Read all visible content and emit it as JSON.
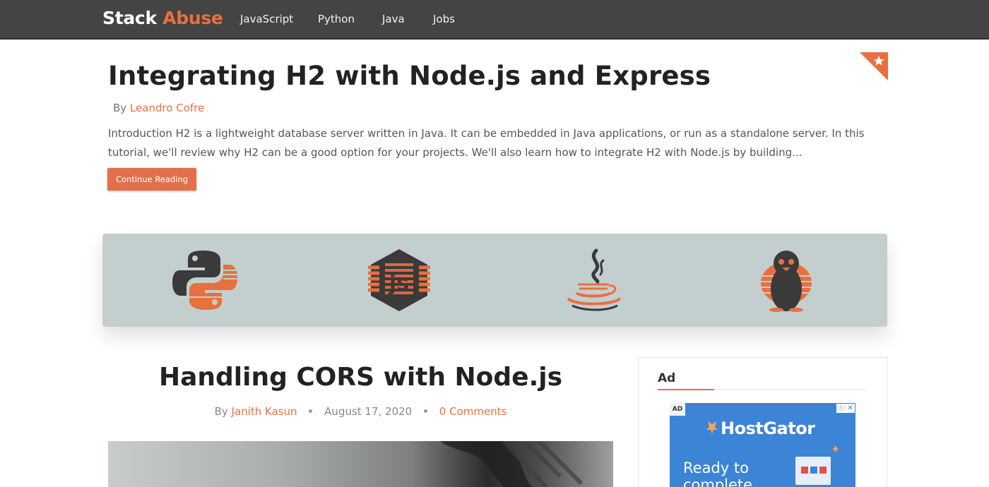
{
  "nav": {
    "brand_part1": "Stack",
    "brand_part2": "Abuse",
    "links": [
      "JavaScript",
      "Python",
      "Java",
      "Jobs"
    ]
  },
  "featured": {
    "title": "Integrating H2 with Node.js and Express",
    "by": "By",
    "author": "Leandro Cofre",
    "excerpt": "Introduction H2 is a lightweight database server written in Java. It can be embedded in Java applications, or run as a standalone server. In this tutorial, we'll review why H2 can be a good option for your projects. We'll also learn how to integrate H2 with Node.js by building...",
    "button_label": "Continue Reading"
  },
  "banner": {
    "icons": [
      "python-icon",
      "nodejs-icon",
      "java-icon",
      "linux-tux-icon"
    ]
  },
  "post": {
    "title": "Handling CORS with Node.js",
    "by": "By",
    "author": "Janith Kasun",
    "date": "August 17, 2020",
    "comments": "0 Comments"
  },
  "sidebar": {
    "heading": "Ad",
    "ad": {
      "tag": "AD",
      "brand": "HostGator",
      "text_line1": "Ready to",
      "text_line2": "complete"
    }
  },
  "colors": {
    "accent": "#e8703f",
    "navbar": "#444444",
    "banner": "#c3cfcf",
    "ad_blue": "#3c84d6"
  }
}
